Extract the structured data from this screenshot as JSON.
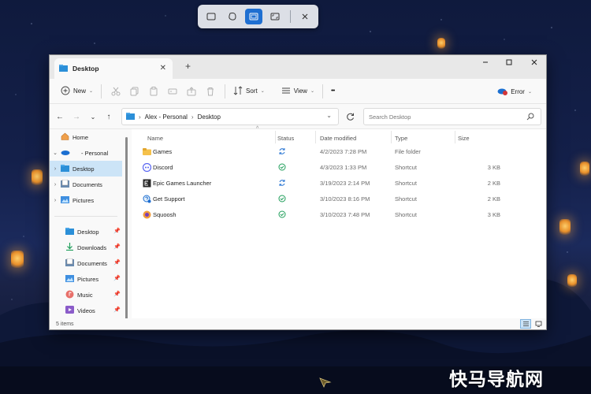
{
  "snip_toolbar": {
    "icons": [
      "rectangle-snip-icon",
      "freeform-snip-icon",
      "window-snip-icon",
      "fullscreen-snip-icon",
      "close-icon"
    ],
    "active": "window-snip-icon",
    "accent": "#1f6fd1"
  },
  "window": {
    "tab_title": "Desktop",
    "new_tab": "+",
    "controls": [
      "minimize-icon",
      "maximize-icon",
      "close-icon"
    ]
  },
  "toolbar": {
    "new_label": "New",
    "sort_label": "Sort",
    "view_label": "View",
    "more_label": "•••",
    "error_label": "Error"
  },
  "address": {
    "path": [
      "Alex - Personal",
      "Desktop"
    ],
    "search_placeholder": "Search Desktop"
  },
  "nav": {
    "items": [
      {
        "label": "Home",
        "icon": "home-icon"
      },
      {
        "label": "- Personal",
        "icon": "onedrive-icon"
      },
      {
        "label": "Desktop",
        "icon": "desktop-folder-icon",
        "selected": true
      },
      {
        "label": "Documents",
        "icon": "documents-icon"
      },
      {
        "label": "Pictures",
        "icon": "pictures-icon"
      }
    ],
    "pinned": [
      {
        "label": "Desktop",
        "icon": "desktop-folder-icon"
      },
      {
        "label": "Downloads",
        "icon": "downloads-icon"
      },
      {
        "label": "Documents",
        "icon": "documents-icon"
      },
      {
        "label": "Pictures",
        "icon": "pictures-icon"
      },
      {
        "label": "Music",
        "icon": "music-icon"
      },
      {
        "label": "Videos",
        "icon": "videos-icon"
      }
    ]
  },
  "files": {
    "columns": [
      "Name",
      "Status",
      "Date modified",
      "Type",
      "Size"
    ],
    "rows": [
      {
        "name": "Games",
        "date": "4/2/2023 7:28 PM",
        "type": "File folder",
        "size": "",
        "status": "sync"
      },
      {
        "name": "Discord",
        "date": "4/3/2023 1:33 PM",
        "type": "Shortcut",
        "size": "3 KB",
        "status": "ok"
      },
      {
        "name": "Epic Games Launcher",
        "date": "3/19/2023 2:14 PM",
        "type": "Shortcut",
        "size": "2 KB",
        "status": "sync"
      },
      {
        "name": "Get Support",
        "date": "3/10/2023 8:16 PM",
        "type": "Shortcut",
        "size": "2 KB",
        "status": "ok"
      },
      {
        "name": "Squoosh",
        "date": "3/10/2023 7:48 PM",
        "type": "Shortcut",
        "size": "3 KB",
        "status": "ok"
      }
    ]
  },
  "status": {
    "count": "5 items"
  },
  "watermark": "快马导航网"
}
